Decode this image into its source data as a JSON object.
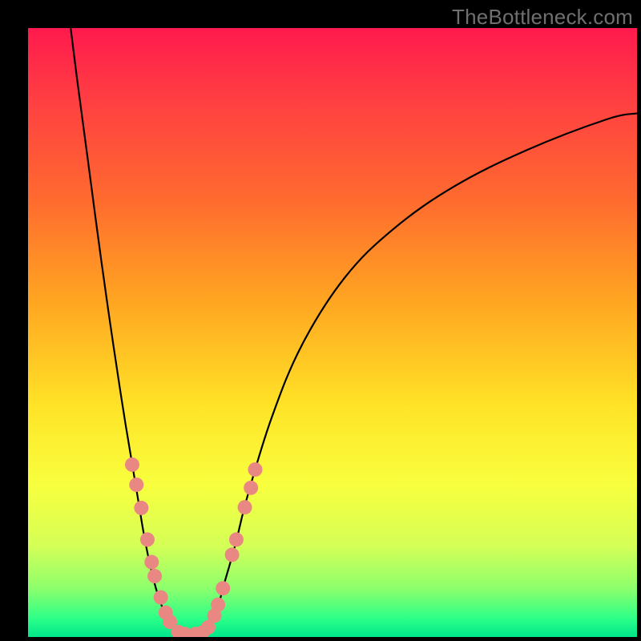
{
  "branding": {
    "text": "TheBottleneck.com"
  },
  "chart_data": {
    "type": "line",
    "title": "",
    "xlabel": "",
    "ylabel": "",
    "xlim": [
      0,
      100
    ],
    "ylim": [
      0,
      100
    ],
    "series": [
      {
        "name": "left-curve",
        "x": [
          7,
          8,
          10,
          12,
          14,
          16,
          18,
          19,
          20,
          21,
          22,
          23,
          24,
          25,
          26
        ],
        "y": [
          100,
          92,
          77,
          62,
          48,
          35,
          23,
          17,
          12,
          8,
          5,
          3,
          1.5,
          0.6,
          0
        ]
      },
      {
        "name": "right-curve",
        "x": [
          29,
          30,
          31,
          32,
          34,
          36,
          40,
          45,
          52,
          60,
          70,
          82,
          95,
          100
        ],
        "y": [
          0,
          1.5,
          4,
          8,
          15,
          23,
          36,
          48,
          59,
          67,
          74,
          80,
          85,
          86
        ]
      }
    ],
    "markers": {
      "name": "salmon-dots",
      "color": "#e98882",
      "radius_px": 9,
      "points": [
        {
          "x": 17.1,
          "y": 28.3
        },
        {
          "x": 17.8,
          "y": 25.0
        },
        {
          "x": 18.6,
          "y": 21.2
        },
        {
          "x": 19.6,
          "y": 16.0
        },
        {
          "x": 20.3,
          "y": 12.3
        },
        {
          "x": 20.8,
          "y": 10.0
        },
        {
          "x": 21.8,
          "y": 6.5
        },
        {
          "x": 22.6,
          "y": 4.0
        },
        {
          "x": 23.3,
          "y": 2.5
        },
        {
          "x": 24.7,
          "y": 0.8
        },
        {
          "x": 25.7,
          "y": 0.5
        },
        {
          "x": 27.5,
          "y": 0.5
        },
        {
          "x": 28.6,
          "y": 0.7
        },
        {
          "x": 29.6,
          "y": 1.6
        },
        {
          "x": 30.6,
          "y": 3.5
        },
        {
          "x": 31.2,
          "y": 5.3
        },
        {
          "x": 32.0,
          "y": 8.0
        },
        {
          "x": 33.5,
          "y": 13.5
        },
        {
          "x": 34.2,
          "y": 16.0
        },
        {
          "x": 35.6,
          "y": 21.3
        },
        {
          "x": 36.6,
          "y": 24.5
        },
        {
          "x": 37.3,
          "y": 27.5
        }
      ]
    }
  }
}
